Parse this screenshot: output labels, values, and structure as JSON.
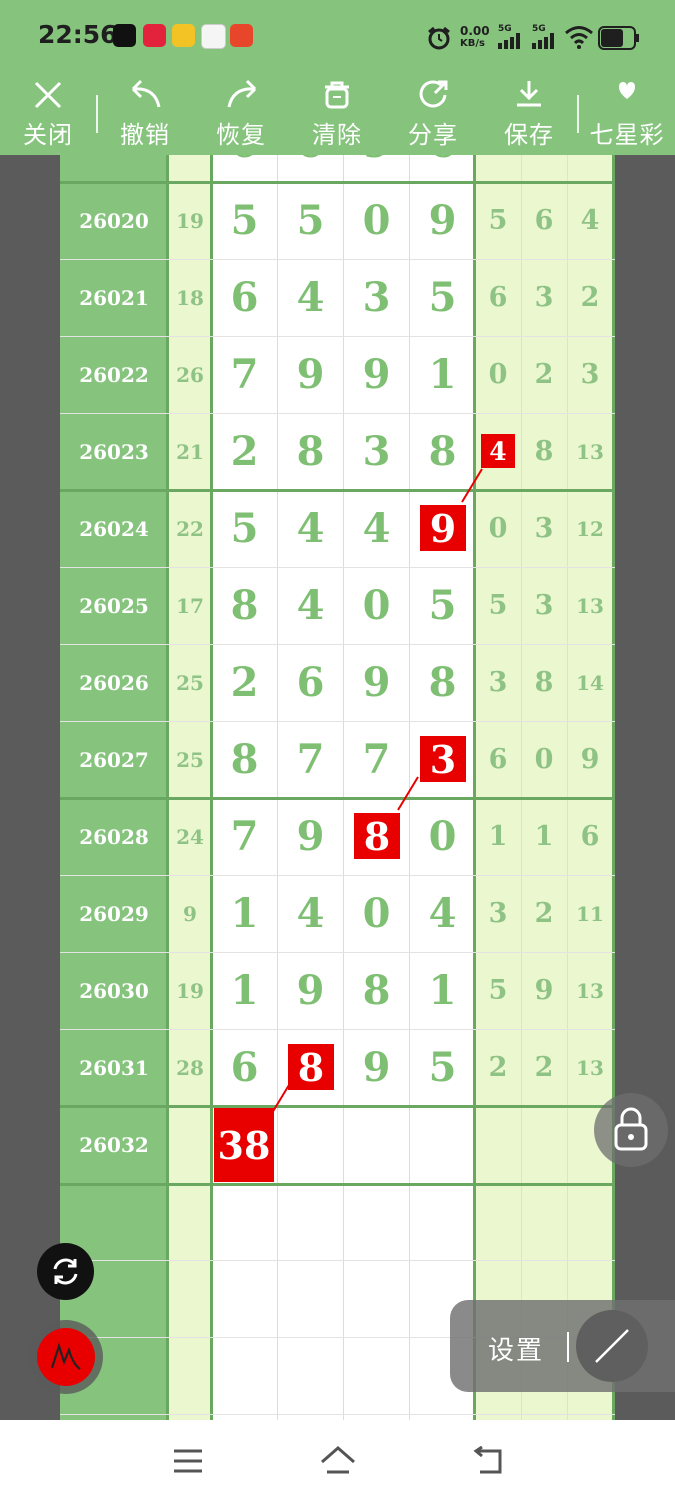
{
  "status_bar": {
    "time": "22:56",
    "speed_value": "0.00",
    "speed_unit": "KB/s",
    "net1": "5G",
    "net2": "5G",
    "app_icons": [
      "tiktok-icon",
      "app-red-icon",
      "app-yellow-icon",
      "app-avatar-icon",
      "app-red2-icon"
    ]
  },
  "toolbar": {
    "items": [
      {
        "label": "关闭",
        "icon": "close-icon"
      },
      {
        "label": "撤销",
        "icon": "undo-icon"
      },
      {
        "label": "恢复",
        "icon": "redo-icon"
      },
      {
        "label": "清除",
        "icon": "trash-icon"
      },
      {
        "label": "分享",
        "icon": "share-icon"
      },
      {
        "label": "保存",
        "icon": "download-icon"
      },
      {
        "label": "七星彩",
        "icon": "heart-dropdown-icon"
      }
    ]
  },
  "grid": {
    "rows": [
      {
        "id": "26020",
        "sum": "19",
        "d": [
          "5",
          "5",
          "0",
          "9"
        ],
        "s": [
          "5",
          "6",
          "4"
        ]
      },
      {
        "id": "26021",
        "sum": "18",
        "d": [
          "6",
          "4",
          "3",
          "5"
        ],
        "s": [
          "6",
          "3",
          "2"
        ]
      },
      {
        "id": "26022",
        "sum": "26",
        "d": [
          "7",
          "9",
          "9",
          "1"
        ],
        "s": [
          "0",
          "2",
          "3"
        ]
      },
      {
        "id": "26023",
        "sum": "21",
        "d": [
          "2",
          "8",
          "3",
          "8"
        ],
        "s": [
          "4",
          "8",
          "13"
        ]
      },
      {
        "id": "26024",
        "sum": "22",
        "d": [
          "5",
          "4",
          "4",
          "9"
        ],
        "s": [
          "0",
          "3",
          "12"
        ]
      },
      {
        "id": "26025",
        "sum": "17",
        "d": [
          "8",
          "4",
          "0",
          "5"
        ],
        "s": [
          "5",
          "3",
          "13"
        ]
      },
      {
        "id": "26026",
        "sum": "25",
        "d": [
          "2",
          "6",
          "9",
          "8"
        ],
        "s": [
          "3",
          "8",
          "14"
        ]
      },
      {
        "id": "26027",
        "sum": "25",
        "d": [
          "8",
          "7",
          "7",
          "3"
        ],
        "s": [
          "6",
          "0",
          "9"
        ]
      },
      {
        "id": "26028",
        "sum": "24",
        "d": [
          "7",
          "9",
          "8",
          "0"
        ],
        "s": [
          "1",
          "1",
          "6"
        ]
      },
      {
        "id": "26029",
        "sum": "9",
        "d": [
          "1",
          "4",
          "0",
          "4"
        ],
        "s": [
          "3",
          "2",
          "11"
        ]
      },
      {
        "id": "26030",
        "sum": "19",
        "d": [
          "1",
          "9",
          "8",
          "1"
        ],
        "s": [
          "5",
          "9",
          "13"
        ]
      },
      {
        "id": "26031",
        "sum": "28",
        "d": [
          "6",
          "8",
          "9",
          "5"
        ],
        "s": [
          "2",
          "2",
          "13"
        ]
      },
      {
        "id": "26032",
        "sum": "",
        "d": [
          "38",
          "",
          "",
          ""
        ],
        "s": [
          "",
          "",
          ""
        ]
      }
    ],
    "highlights": [
      {
        "row": 3,
        "col": "s0"
      },
      {
        "row": 4,
        "col": "d3"
      },
      {
        "row": 7,
        "col": "d3"
      },
      {
        "row": 8,
        "col": "d2"
      },
      {
        "row": 11,
        "col": "d1"
      },
      {
        "row": 12,
        "col": "d0"
      }
    ]
  },
  "floating": {
    "settings_label": "设置",
    "lock_icon": "lock-icon",
    "refresh_icon": "refresh-icon",
    "pen_icon": "pen-icon",
    "line_icon": "line-tool-icon"
  },
  "nav": {
    "icons": [
      "menu-icon",
      "home-icon",
      "back-icon"
    ]
  },
  "colors": {
    "green": "#86c47e",
    "green_dark": "#6aa862",
    "light_green": "#eaf7cf",
    "highlight_red": "#e80000",
    "digit_green": "#7fbf73"
  }
}
